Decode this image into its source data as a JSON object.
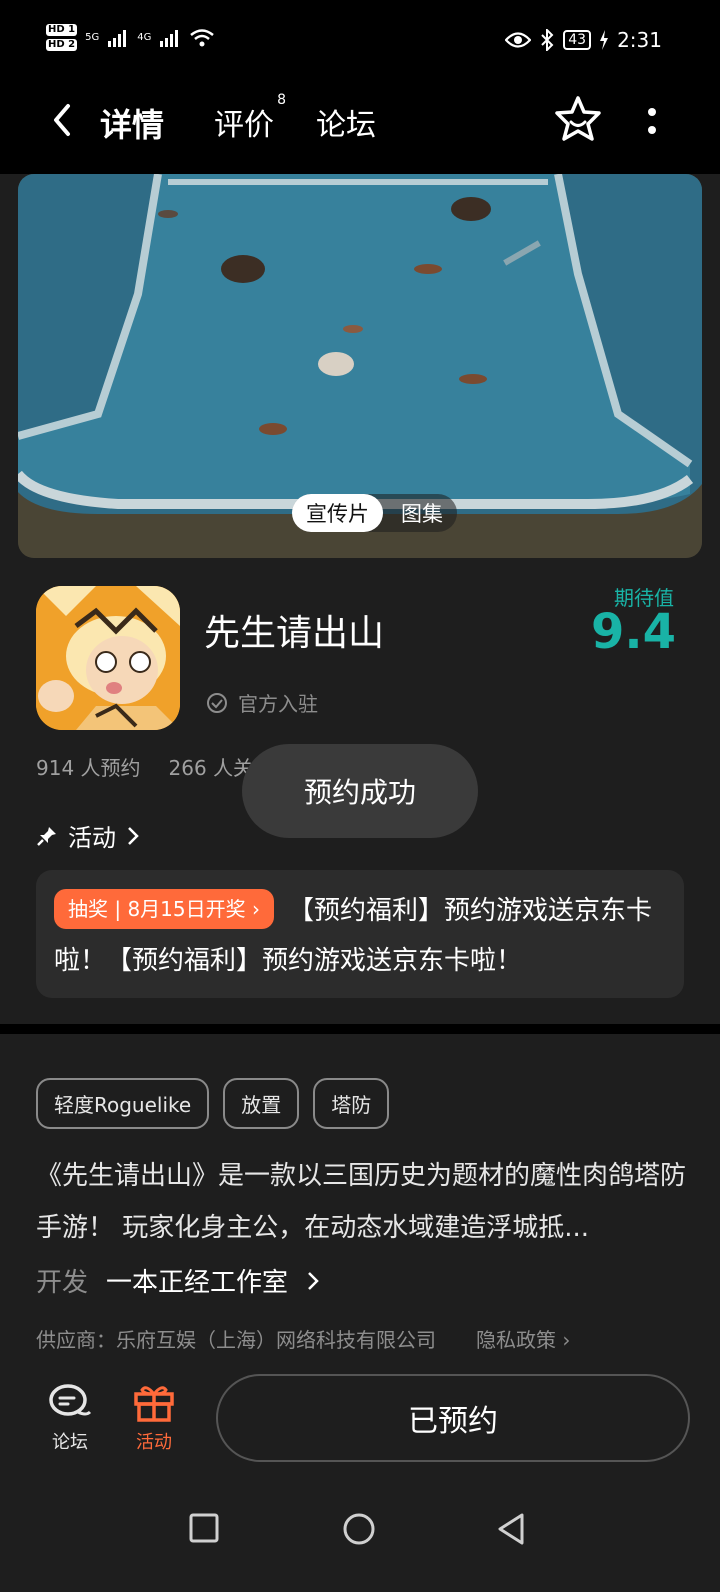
{
  "status_bar": {
    "hd1": "HD 1",
    "hd2": "HD 2",
    "signal1": "5G",
    "signal2": "4G",
    "battery": "43",
    "time": "2:31"
  },
  "top_nav": {
    "tabs": [
      {
        "label": "详情",
        "active": true
      },
      {
        "label": "评价",
        "badge": "8"
      },
      {
        "label": "论坛"
      }
    ]
  },
  "media": {
    "tabs": [
      {
        "label": "宣传片",
        "active": true
      },
      {
        "label": "图集"
      }
    ]
  },
  "game": {
    "title": "先生请出山",
    "official": "官方入驻",
    "expect_label": "期待值",
    "expect_value": "9.4"
  },
  "stats": {
    "reservations": "914 人预约",
    "follows": "266 人关"
  },
  "activity": {
    "header": "活动",
    "badge": "抽奖 | 8月15日开奖 ›",
    "text": "【预约福利】预约游戏送京东卡啦！【预约福利】预约游戏送京东卡啦！"
  },
  "tags": [
    "轻度Roguelike",
    "放置",
    "塔防"
  ],
  "description": "《先生请出山》是一款以三国历史为题材的魔性肉鸽塔防手游！ 玩家化身主公，在动态水域建造浮城抵...",
  "developer": {
    "label": "开发",
    "name": "一本正经工作室"
  },
  "supplier": {
    "text": "供应商：乐府互娱（上海）网络科技有限公司",
    "privacy": "隐私政策 ›"
  },
  "toast": "预约成功",
  "bottom_bar": {
    "forum": "论坛",
    "activity": "活动",
    "reserved": "已预约"
  },
  "colors": {
    "accent": "#19b3a6",
    "orange": "#ff6a3a",
    "background": "#1e1e1e"
  }
}
